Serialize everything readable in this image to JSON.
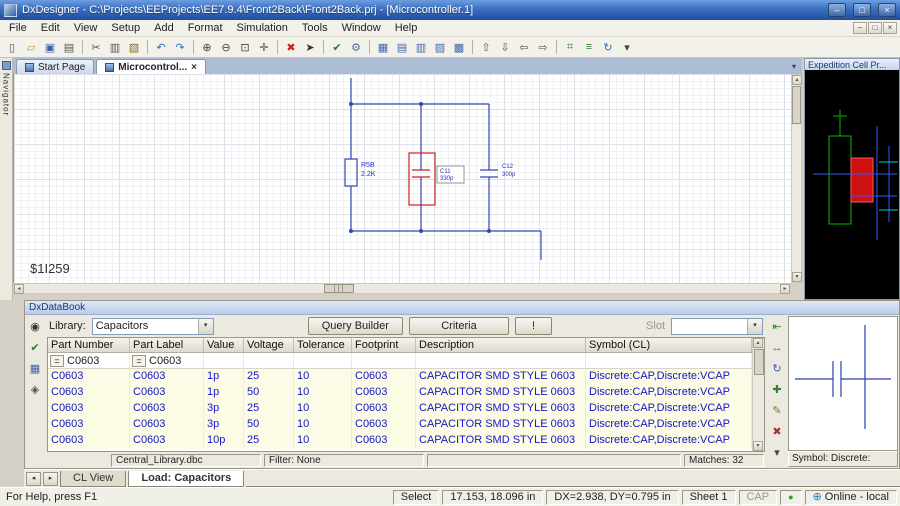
{
  "window": {
    "title": "DxDesigner - C:\\Projects\\EEProjects\\EE7.9.4\\Front2Back\\Front2Back.prj - [Microcontroller.1]",
    "controls": {
      "minimize": "–",
      "restore": "□",
      "close": "×"
    }
  },
  "menu": {
    "items": [
      "File",
      "Edit",
      "View",
      "Setup",
      "Add",
      "Format",
      "Simulation",
      "Tools",
      "Window",
      "Help"
    ]
  },
  "toolbar": {
    "icons": [
      {
        "name": "new-document-icon",
        "glyph": "▯",
        "color": "#555555"
      },
      {
        "name": "open-icon",
        "glyph": "▱",
        "color": "#c9a227"
      },
      {
        "name": "save-icon",
        "glyph": "▣",
        "color": "#3a5fa8"
      },
      {
        "name": "print-icon",
        "glyph": "▤",
        "color": "#555555"
      },
      {
        "sep": true
      },
      {
        "name": "cut-icon",
        "glyph": "✂",
        "color": "#555555"
      },
      {
        "name": "copy-icon",
        "glyph": "▥",
        "color": "#555555"
      },
      {
        "name": "paste-icon",
        "glyph": "▧",
        "color": "#8a6a2a"
      },
      {
        "sep": true
      },
      {
        "name": "undo-icon",
        "glyph": "↶",
        "color": "#2a6fbf"
      },
      {
        "name": "redo-icon",
        "glyph": "↷",
        "color": "#2a6fbf"
      },
      {
        "sep": true
      },
      {
        "name": "zoom-in-icon",
        "glyph": "⊕",
        "color": "#444444"
      },
      {
        "name": "zoom-out-icon",
        "glyph": "⊖",
        "color": "#444444"
      },
      {
        "name": "zoom-fit-icon",
        "glyph": "⊡",
        "color": "#444444"
      },
      {
        "name": "pan-icon",
        "glyph": "✛",
        "color": "#444444"
      },
      {
        "sep": true
      },
      {
        "name": "delete-icon",
        "glyph": "✖",
        "color": "#cc2222"
      },
      {
        "name": "select-icon",
        "glyph": "➤",
        "color": "#333333"
      },
      {
        "sep": true
      },
      {
        "name": "verify-icon",
        "glyph": "✔",
        "color": "#2a7f2a"
      },
      {
        "name": "packager-icon",
        "glyph": "⚙",
        "color": "#4a6f9f"
      },
      {
        "sep": true
      },
      {
        "name": "grid-icon",
        "glyph": "▦",
        "color": "#4466aa"
      },
      {
        "name": "add-row-icon",
        "glyph": "▤",
        "color": "#4466aa"
      },
      {
        "name": "add-column-icon",
        "glyph": "▥",
        "color": "#4466aa"
      },
      {
        "name": "merge-cells-icon",
        "glyph": "▨",
        "color": "#4466aa"
      },
      {
        "name": "split-cells-icon",
        "glyph": "▩",
        "color": "#4466aa"
      },
      {
        "sep": true
      },
      {
        "name": "promote-icon",
        "glyph": "⇧",
        "color": "#555555"
      },
      {
        "name": "demote-icon",
        "glyph": "⇩",
        "color": "#555555"
      },
      {
        "name": "back-icon",
        "glyph": "⇦",
        "color": "#555555"
      },
      {
        "name": "forward-icon",
        "glyph": "⇨",
        "color": "#555555"
      },
      {
        "sep": true
      },
      {
        "name": "component-icon",
        "glyph": "⌗",
        "color": "#3a7f3a"
      },
      {
        "name": "net-icon",
        "glyph": "≡",
        "color": "#3a7f3a"
      },
      {
        "name": "refresh-icon",
        "glyph": "↻",
        "color": "#2a6fbf"
      },
      {
        "name": "toolbar-options-icon",
        "glyph": "▾",
        "color": "#444444"
      }
    ]
  },
  "tabbar": {
    "tabs": [
      {
        "label": "Start Page",
        "active": false
      },
      {
        "label": "Microcontrol...",
        "active": true,
        "close": "×"
      }
    ],
    "dropdown_arrow": "▾"
  },
  "navigator": {
    "label": "Navigator"
  },
  "schematic": {
    "r5b": {
      "ref": "R5B",
      "value": "2.2K"
    },
    "c11": {
      "ref": "C11",
      "value": "330p"
    },
    "c12": {
      "ref": "C12",
      "value": "300p"
    },
    "net_label": "$1I259"
  },
  "cell_panel": {
    "title": "Expedition Cell Pr..."
  },
  "databook": {
    "title": "DxDataBook",
    "library_label": "Library:",
    "library_value": "Capacitors",
    "query_builder_label": "Query Builder",
    "criteria_label": "Criteria",
    "bang_label": "!",
    "slot_label": "Slot",
    "columns": [
      "Part Number",
      "Part Label",
      "Value",
      "Voltage",
      "Tolerance",
      "Footprint",
      "Description",
      "Symbol (CL)"
    ],
    "filter": {
      "op": "=",
      "values": [
        "C0603",
        "C0603",
        "",
        "",
        "",
        "",
        "",
        ""
      ]
    },
    "rows": [
      [
        "C0603",
        "C0603",
        "1p",
        "25",
        "10",
        "C0603",
        "CAPACITOR SMD STYLE 0603",
        "Discrete:CAP,Discrete:VCAP"
      ],
      [
        "C0603",
        "C0603",
        "1p",
        "50",
        "10",
        "C0603",
        "CAPACITOR SMD STYLE 0603",
        "Discrete:CAP,Discrete:VCAP"
      ],
      [
        "C0603",
        "C0603",
        "3p",
        "25",
        "10",
        "C0603",
        "CAPACITOR SMD STYLE 0603",
        "Discrete:CAP,Discrete:VCAP"
      ],
      [
        "C0603",
        "C0603",
        "3p",
        "50",
        "10",
        "C0603",
        "CAPACITOR SMD STYLE 0603",
        "Discrete:CAP,Discrete:VCAP"
      ],
      [
        "C0603",
        "C0603",
        "10p",
        "25",
        "10",
        "C0603",
        "CAPACITOR SMD STYLE 0603",
        "Discrete:CAP,Discrete:VCAP"
      ]
    ],
    "db_file": "Central_Library.dbc",
    "filter_status": "Filter: None",
    "matches": "Matches: 32",
    "left_icons": [
      {
        "name": "find-parts-icon",
        "glyph": "◉",
        "color": "#333333"
      },
      {
        "name": "verify-part-icon",
        "glyph": "✔",
        "color": "#2a7f2a"
      },
      {
        "name": "place-part-icon",
        "glyph": "▦",
        "color": "#3a5fa8"
      },
      {
        "name": "search-symbols-icon",
        "glyph": "◈",
        "color": "#555555"
      }
    ],
    "right_icons": [
      {
        "name": "place-symbol-icon",
        "glyph": "⇤",
        "color": "#2a7f2a"
      },
      {
        "name": "swap-symbol-icon",
        "glyph": "↔",
        "color": "#2a7f2a"
      },
      {
        "name": "rotate-symbol-icon",
        "glyph": "↻",
        "color": "#3a5fa8"
      },
      {
        "name": "add-symbol-icon",
        "glyph": "✚",
        "color": "#3a7f3a"
      },
      {
        "name": "edit-symbol-icon",
        "glyph": "✎",
        "color": "#8a6a2a"
      },
      {
        "name": "remove-symbol-icon",
        "glyph": "✖",
        "color": "#aa3333"
      },
      {
        "name": "symbol-options-icon",
        "glyph": "▾",
        "color": "#444444"
      }
    ],
    "sheet_tabs": [
      {
        "label": "CL View",
        "active": false
      },
      {
        "label": "Load: Capacitors",
        "active": true
      }
    ]
  },
  "symbol_panel": {
    "label": "Symbol: Discrete:"
  },
  "statusbar": {
    "help": "For Help, press F1",
    "mode": "Select",
    "coords": "17.153, 18.096 in",
    "delta": "DX=2.938, DY=0.795 in",
    "sheet": "Sheet 1",
    "caps": "CAP",
    "led": "●",
    "globe": "⊕",
    "online": "Online - local"
  },
  "ui": {
    "scroll_up": "▴",
    "scroll_down": "▾",
    "scroll_left": "◂",
    "scroll_right": "▸",
    "tab_prev": "◂",
    "tab_next": "▸",
    "dropdown_arrow": "▾"
  }
}
